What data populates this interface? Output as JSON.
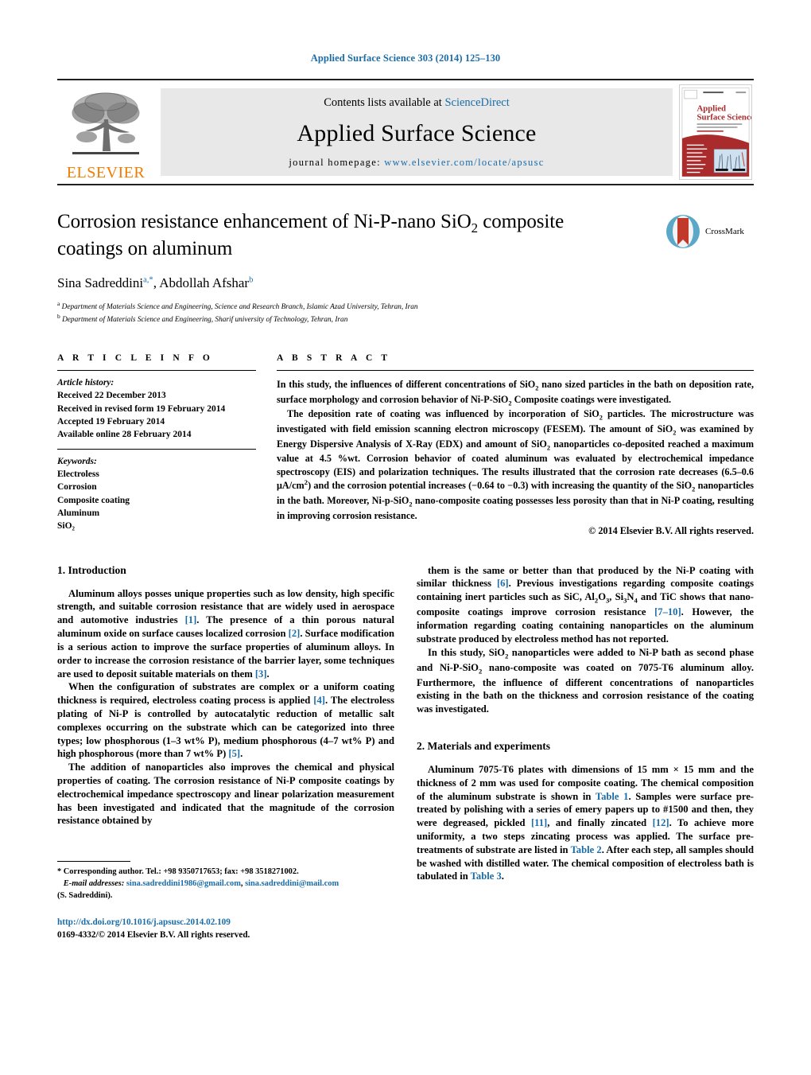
{
  "running_head": "Applied Surface Science 303 (2014) 125–130",
  "masthead": {
    "contents_prefix": "Contents lists available at ",
    "sciencedirect": "ScienceDirect",
    "journal_title": "Applied Surface Science",
    "homepage_prefix": "journal homepage: ",
    "homepage_url": "www.elsevier.com/locate/apsusc",
    "publisher": "ELSEVIER",
    "tree_icon": "elsevier-tree-icon",
    "cover_title_line1": "Applied",
    "cover_title_line2": "Surface Science"
  },
  "article": {
    "title_part1": "Corrosion resistance enhancement of Ni-P-nano SiO",
    "title_sub": "2",
    "title_part2": " composite",
    "title_line2": "coatings on aluminum",
    "authors": [
      {
        "name": "Sina Sadreddini",
        "marks": "a,*"
      },
      {
        "name": "Abdollah Afshar",
        "marks": "b"
      }
    ],
    "affiliations": [
      {
        "mark": "a",
        "text": "Department of Materials Science and Engineering, Science and Research Branch, Islamic Azad University, Tehran, Iran"
      },
      {
        "mark": "b",
        "text": "Department of Materials Science and Engineering, Sharif university of Technology, Tehran, Iran"
      }
    ],
    "crossmark_label": "CrossMark"
  },
  "article_info": {
    "heading": "A R T I C L E   I N F O",
    "history_label": "Article history:",
    "history": [
      "Received 22 December 2013",
      "Received in revised form 19 February 2014",
      "Accepted 19 February 2014",
      "Available online 28 February 2014"
    ],
    "keywords_label": "Keywords:",
    "keywords": [
      "Electroless",
      "Corrosion",
      "Composite coating",
      "Aluminum",
      "SiO₂"
    ]
  },
  "abstract": {
    "heading": "A B S T R A C T",
    "paragraph1": "In this study, the influences of different concentrations of SiO2 nano sized particles in the bath on deposition rate, surface morphology and corrosion behavior of Ni-P-SiO2 Composite coatings were investigated.",
    "paragraph2": "The deposition rate of coating was influenced by incorporation of SiO2 particles. The microstructure was investigated with field emission scanning electron microscopy (FESEM). The amount of SiO2 was examined by Energy Dispersive Analysis of X-Ray (EDX) and amount of SiO2 nanoparticles co-deposited reached a maximum value at 4.5 %wt. Corrosion behavior of coated aluminum was evaluated by electrochemical impedance spectroscopy (EIS) and polarization techniques. The results illustrated that the corrosion rate decreases (6.5–0.6 μA/cm2) and the corrosion potential increases (−0.64 to −0.3) with increasing the quantity of the SiO2 nanoparticles in the bath. Moreover, Ni-p-SiO2 nano-composite coating possesses less porosity than that in Ni-P coating, resulting in improving corrosion resistance.",
    "copyright": "© 2014 Elsevier B.V. All rights reserved."
  },
  "sections": {
    "intro_heading": "1.  Introduction",
    "materials_heading": "2.  Materials and experiments"
  },
  "intro": {
    "p1": "Aluminum alloys posses unique properties such as low density, high specific strength, and suitable corrosion resistance that are widely used in aerospace and automotive industries [1]. The presence of a thin porous natural aluminum oxide on surface causes localized corrosion [2]. Surface modification is a serious action to improve the surface properties of aluminum alloys. In order to increase the corrosion resistance of the barrier layer, some techniques are used to deposit suitable materials on them [3].",
    "p2": "When the configuration of substrates are complex or a uniform coating thickness is required, electroless coating process is applied [4]. The electroless plating of Ni-P is controlled by autocatalytic reduction of metallic salt complexes occurring on the substrate which can be categorized into three types; low phosphorous (1–3 wt% P), medium phosphorous (4–7 wt% P) and high phosphorous (more than 7 wt% P) [5].",
    "p3": "The addition of nanoparticles also improves the chemical and physical properties of coating. The corrosion resistance of Ni-P composite coatings by electrochemical impedance spectroscopy and linear polarization measurement has been investigated and indicated that the magnitude of the corrosion resistance obtained by",
    "p4": "them is the same or better than that produced by the Ni-P coating with similar thickness [6]. Previous investigations regarding composite coatings containing inert particles such as SiC, Al2O3, Si3N4 and TiC shows that nano-composite coatings improve corrosion resistance [7–10]. However, the information regarding coating containing nanoparticles on the aluminum substrate produced by electroless method has not reported.",
    "p5": "In this study, SiO2 nanoparticles were added to Ni-P bath as second phase and Ni-P-SiO2 nano-composite was coated on 7075-T6 aluminum alloy. Furthermore, the influence of different concentrations of nanoparticles existing in the bath on the thickness and corrosion resistance of the coating was investigated."
  },
  "materials": {
    "p1": "Aluminum 7075-T6 plates with dimensions of 15 mm × 15 mm and the thickness of 2 mm was used for composite coating. The chemical composition of the aluminum substrate is shown in Table 1. Samples were surface pre-treated by polishing with a series of emery papers up to #1500 and then, they were degreased, pickled [11], and finally zincated [12]. To achieve more uniformity, a two steps zincating process was applied. The surface pre-treatments of substrate are listed in Table 2. After each step, all samples should be washed with distilled water. The chemical composition of electroless bath is tabulated in Table 3."
  },
  "footnotes": {
    "corresponding": "*  Corresponding author. Tel.: +98 9350717653; fax: +98 3518271002.",
    "email_label": "E-mail addresses:",
    "email1": "sina.sadreddini1986@gmail.com",
    "email2": "sina.sadreddini@mail.com",
    "email_owner": "(S. Sadreddini).",
    "doi": "http://dx.doi.org/10.1016/j.apsusc.2014.02.109",
    "issn_line": "0169-4332/© 2014 Elsevier B.V. All rights reserved."
  },
  "colors": {
    "link": "#1a6ca8",
    "elsevier_orange": "#f07d00",
    "masthead_bg": "#e8e8e8",
    "cover_red": "#a92b2b"
  }
}
